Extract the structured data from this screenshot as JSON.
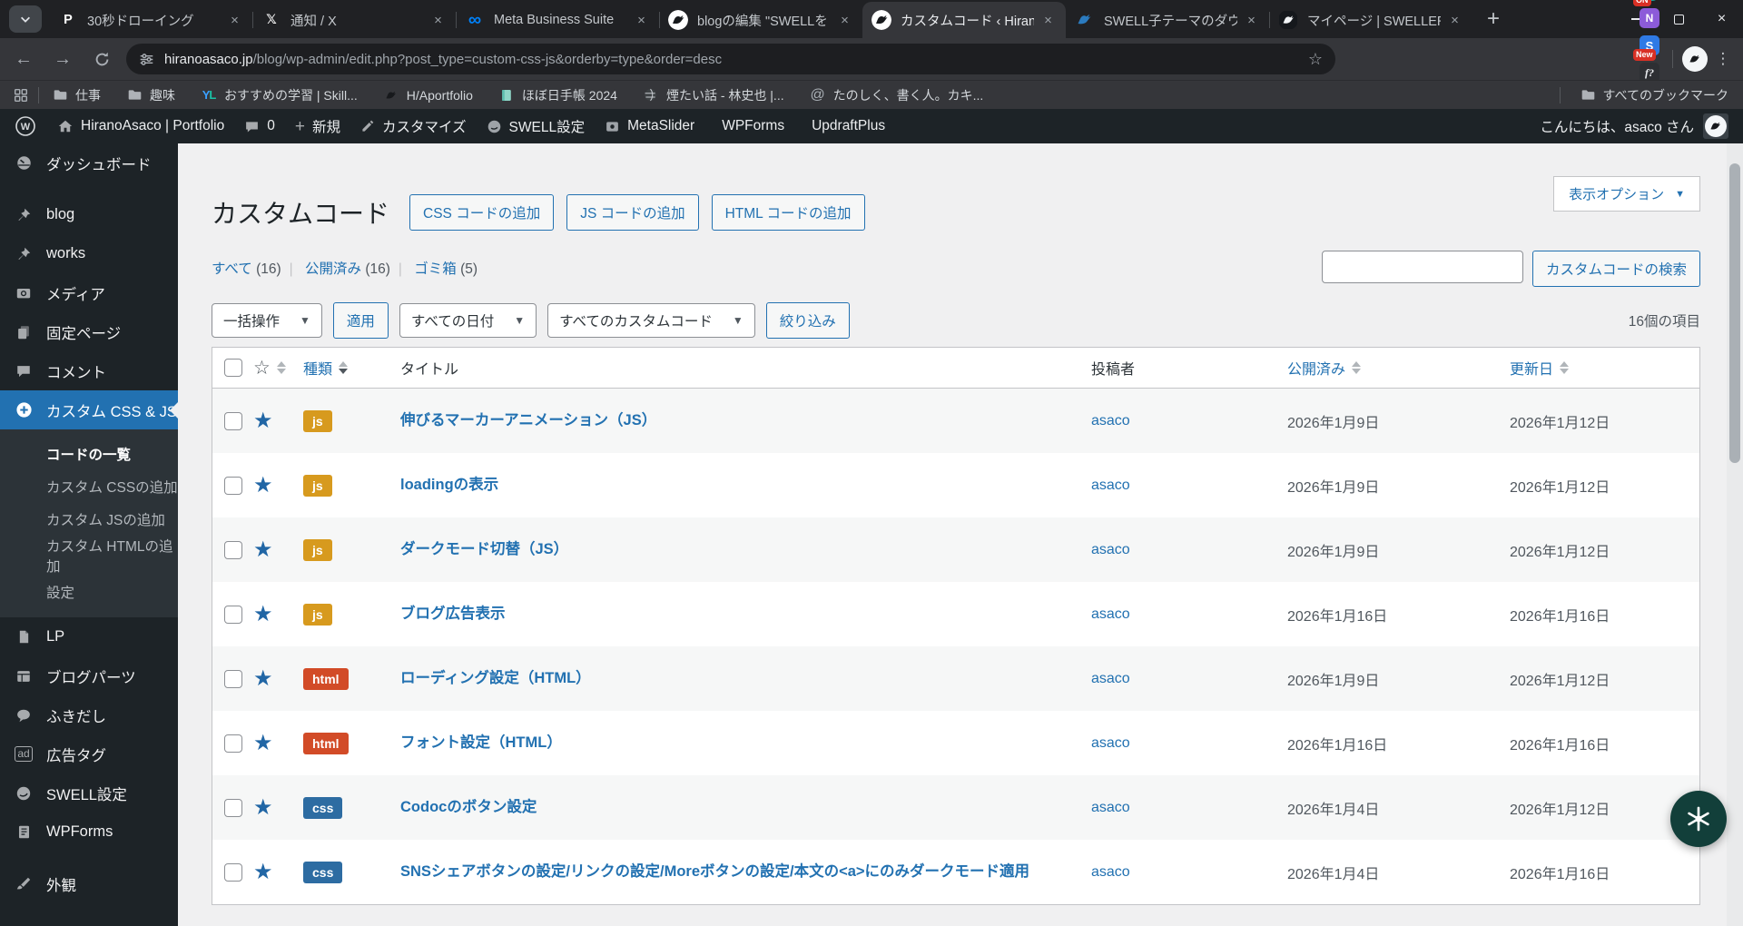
{
  "colors": {
    "accent": "#2271b1",
    "chat_widget": "#123f3a"
  },
  "browser": {
    "tabs": [
      {
        "title": "30秒ドローイング",
        "icon": "p-logo"
      },
      {
        "title": "通知 / X",
        "icon": "x-logo"
      },
      {
        "title": "Meta Business Suite",
        "icon": "meta-logo"
      },
      {
        "title": "blogの編集 \"SWELLを",
        "icon": "bird-avatar"
      },
      {
        "title": "カスタムコード ‹ HiranoA",
        "icon": "bird-avatar",
        "active": true
      },
      {
        "title": "SWELL子テーマのダウン",
        "icon": "swallow"
      },
      {
        "title": "マイページ | SWELLERS'",
        "icon": "swellers"
      }
    ],
    "url_host": "hiranoasaco.jp",
    "url_path": "/blog/wp-admin/edit.php?post_type=custom-css-js&orderby=type&order=desc",
    "extensions": [
      {
        "icon": "teal-ext",
        "badge": "ON"
      },
      {
        "icon": "notion-ext",
        "badge": ""
      },
      {
        "icon": "blue-ext",
        "badge": "New"
      },
      {
        "icon": "font-ext",
        "badge": ""
      },
      {
        "icon": "r-ext",
        "badge": ""
      },
      {
        "icon": "puzzle",
        "badge": ""
      }
    ],
    "bookmarks": [
      {
        "label": "仕事",
        "icon": "folder"
      },
      {
        "label": "趣味",
        "icon": "folder"
      },
      {
        "label": "おすすめの学習 | Skill...",
        "icon": "yl-logo"
      },
      {
        "label": "H/Aportfolio",
        "icon": "bird"
      },
      {
        "label": "ほぼ日手帳 2024",
        "icon": "green-book"
      },
      {
        "label": "煙たい話 - 林史也 |...",
        "icon": "globe"
      },
      {
        "label": "たのしく、書く人。カキ...",
        "icon": "at-sign"
      }
    ],
    "bookmarks_all": "すべてのブックマーク"
  },
  "adminbar": {
    "items": [
      {
        "label": "HiranoAsaco | Portfolio",
        "icon": "home"
      },
      {
        "label": "0",
        "icon": "comment"
      },
      {
        "label": "新規",
        "icon": "plus"
      },
      {
        "label": "カスタマイズ",
        "icon": "pencil"
      },
      {
        "label": "SWELL設定",
        "icon": "swell-badge"
      },
      {
        "label": "MetaSlider",
        "icon": "metaslider"
      },
      {
        "label": "WPForms"
      },
      {
        "label": "UpdraftPlus"
      }
    ],
    "greeting": "こんにちは、asaco さん"
  },
  "sidebar": {
    "top": [
      {
        "label": "ダッシュボード",
        "icon": "dashboard"
      },
      {
        "label": "blog",
        "icon": "pin",
        "sep": true
      },
      {
        "label": "works",
        "icon": "pin"
      },
      {
        "label": "メディア",
        "icon": "media"
      },
      {
        "label": "固定ページ",
        "icon": "pages"
      },
      {
        "label": "コメント",
        "icon": "comments"
      }
    ],
    "active": {
      "label": "カスタム CSS & JS"
    },
    "submenu": [
      {
        "label": "コードの一覧",
        "current": true
      },
      {
        "label": "カスタム CSSの追加"
      },
      {
        "label": "カスタム JSの追加"
      },
      {
        "label": "カスタム HTMLの追加"
      },
      {
        "label": "設定"
      }
    ],
    "bottom": [
      {
        "label": "LP",
        "icon": "doc"
      },
      {
        "label": "ブログパーツ",
        "icon": "parts"
      },
      {
        "label": "ふきだし",
        "icon": "balloon"
      },
      {
        "label": "広告タグ",
        "icon": "ad"
      },
      {
        "label": "SWELL設定",
        "icon": "swell"
      },
      {
        "label": "WPForms",
        "icon": "wpforms"
      },
      {
        "label": "外観",
        "icon": "appearance",
        "sep": true
      }
    ]
  },
  "page": {
    "title": "カスタムコード",
    "add_buttons": [
      "CSS コードの追加",
      "JS コードの追加",
      "HTML コードの追加"
    ],
    "screen_options": "表示オプション",
    "views": [
      {
        "label": "すべて",
        "count": " (16)"
      },
      {
        "label": "公開済み",
        "count": " (16)"
      },
      {
        "label": "ゴミ箱",
        "count": " (5)"
      }
    ],
    "search_button": "カスタムコードの検索",
    "bulk_select": "一括操作",
    "apply": "適用",
    "date_filter": "すべての日付",
    "type_filter": "すべてのカスタムコード",
    "filter_button": "絞り込み",
    "item_count": "16個の項目",
    "columns": {
      "type": "種類",
      "title": "タイトル",
      "author": "投稿者",
      "published": "公開済み",
      "modified": "更新日"
    },
    "badge_colors": {
      "js": "#d79a1e",
      "html": "#d24b27",
      "css": "#2d6ca2"
    },
    "rows": [
      {
        "type": "js",
        "title": "伸びるマーカーアニメーション（JS）",
        "author": "asaco",
        "published": "2026年1月9日",
        "modified": "2026年1月12日"
      },
      {
        "type": "js",
        "title": "loadingの表示",
        "author": "asaco",
        "published": "2026年1月9日",
        "modified": "2026年1月12日"
      },
      {
        "type": "js",
        "title": "ダークモード切替（JS）",
        "author": "asaco",
        "published": "2026年1月9日",
        "modified": "2026年1月12日"
      },
      {
        "type": "js",
        "title": "ブログ広告表示",
        "author": "asaco",
        "published": "2026年1月16日",
        "modified": "2026年1月16日"
      },
      {
        "type": "html",
        "title": "ローディング設定（HTML）",
        "author": "asaco",
        "published": "2026年1月9日",
        "modified": "2026年1月12日"
      },
      {
        "type": "html",
        "title": "フォント設定（HTML）",
        "author": "asaco",
        "published": "2026年1月16日",
        "modified": "2026年1月16日"
      },
      {
        "type": "css",
        "title": "Codocのボタン設定",
        "author": "asaco",
        "published": "2026年1月4日",
        "modified": "2026年1月12日"
      },
      {
        "type": "css",
        "title": "SNSシェアボタンの設定/リンクの設定/Moreボタンの設定/本文の<a>にのみダークモード適用",
        "author": "asaco",
        "published": "2026年1月4日",
        "modified": "2026年1月16日"
      }
    ]
  }
}
